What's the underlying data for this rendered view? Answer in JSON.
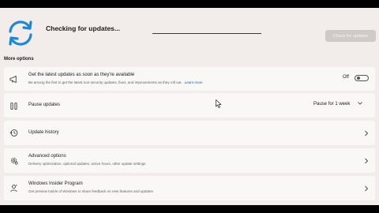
{
  "status": {
    "title": "Checking for updates...",
    "progress": 1,
    "check_button": "Check for updates"
  },
  "section_title": "More options",
  "options": {
    "latest": {
      "title": "Get the latest updates as soon as they're available",
      "description": "Be among the first to get the latest non-security updates, fixes, and improvements as they roll out.",
      "link": "Learn more",
      "toggle_label": "Off",
      "toggle_on": false
    },
    "pause": {
      "title": "Pause updates",
      "select_value": "Pause for 1 week"
    },
    "history": {
      "title": "Update history"
    },
    "advanced": {
      "title": "Advanced options",
      "description": "Delivery optimization, optional updates, active hours, other update settings"
    },
    "insider": {
      "title": "Windows Insider Program",
      "description": "Get preview builds of Windows to share feedback on new features and updates"
    }
  },
  "icons": {
    "sync": "sync-icon",
    "megaphone": "megaphone-icon",
    "pause": "pause-icon",
    "history": "history-icon",
    "gear": "gear-icon",
    "insider": "insider-icon",
    "chevron": "chevron-right-icon"
  },
  "colors": {
    "accent": "#1e88d8",
    "background": "#f2edea",
    "card": "#faf8f7",
    "link": "#1a5fb4"
  }
}
